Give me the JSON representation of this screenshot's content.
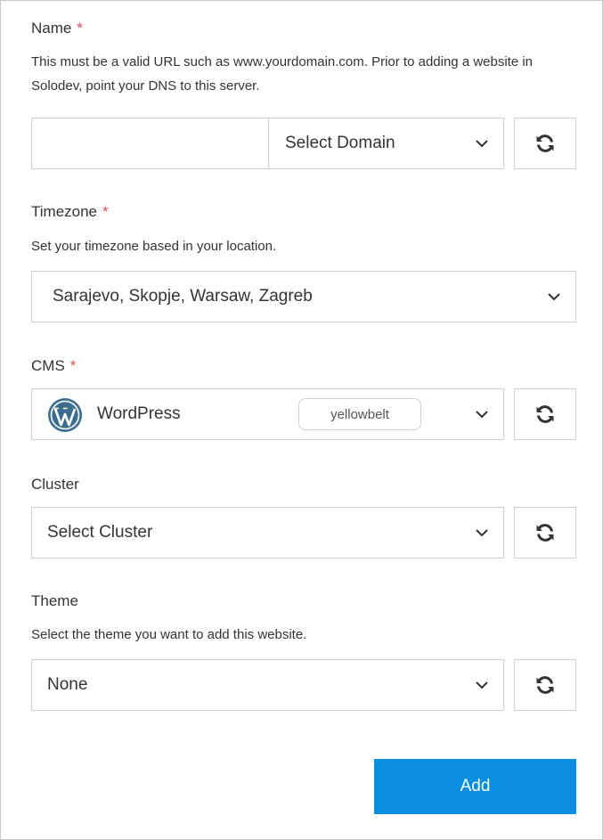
{
  "name_field": {
    "label": "Name",
    "required_mark": "*",
    "help": "This must be a valid URL such as www.yourdomain.com. Prior to adding a website in Solodev, point your DNS to this server.",
    "value": "",
    "domain_select": "Select Domain"
  },
  "timezone_field": {
    "label": "Timezone",
    "required_mark": "*",
    "help": "Set your timezone based in your location.",
    "selected": "Sarajevo, Skopje, Warsaw, Zagreb"
  },
  "cms_field": {
    "label": "CMS",
    "required_mark": "*",
    "selected": "WordPress",
    "badge": "yellowbelt",
    "icon": "wordpress-logo-icon"
  },
  "cluster_field": {
    "label": "Cluster",
    "selected": "Select Cluster"
  },
  "theme_field": {
    "label": "Theme",
    "help": "Select the theme you want to add this website.",
    "selected": "None"
  },
  "actions": {
    "add_label": "Add"
  },
  "icons": {
    "dropdown": "chevron-down-icon",
    "refresh": "refresh-icon"
  },
  "colors": {
    "accent": "#0a8fe0",
    "required": "#d9534f",
    "wordpress": "#3e6e8f"
  }
}
